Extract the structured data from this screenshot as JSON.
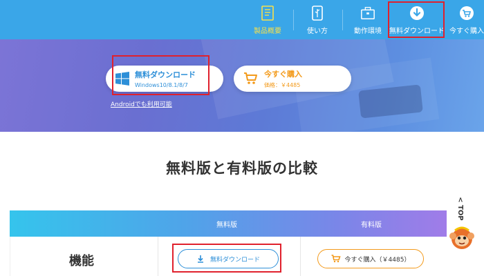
{
  "nav": {
    "items": [
      {
        "label": "製品概要",
        "icon": "book-icon"
      },
      {
        "label": "使い方",
        "icon": "feather-icon"
      },
      {
        "label": "動作環境",
        "icon": "briefcase-icon"
      },
      {
        "label": "無料ダウンロード",
        "icon": "download-circle-icon"
      },
      {
        "label": "今すぐ購入",
        "icon": "cart-icon"
      }
    ]
  },
  "hero": {
    "download_title": "無料ダウンロード",
    "download_sub": "Windows10/8.1/8/7",
    "buy_title": "今すぐ購入",
    "buy_sub": "価格：￥4485",
    "android_link": "Androidでも利用可能"
  },
  "comparison": {
    "title": "無料版と有料版の比較",
    "col_free": "無料版",
    "col_paid": "有料版",
    "row_label": "機能",
    "free_button": "無料ダウンロード",
    "paid_button": "今すぐ購入（￥4485）"
  },
  "side": {
    "top_label": "TOP"
  },
  "colors": {
    "nav_bg": "#3aa6e8",
    "active_label": "#f8e04a",
    "highlight": "#e0202c",
    "download_blue": "#2d8fd8",
    "buy_orange": "#f39a1a"
  }
}
